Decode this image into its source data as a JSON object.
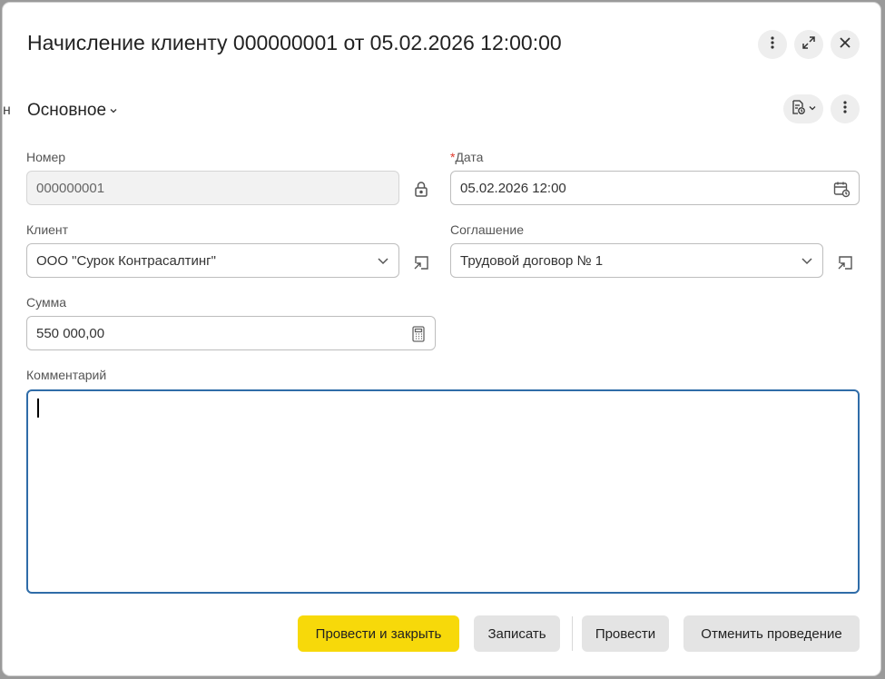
{
  "window": {
    "title": "Начисление клиенту 000000001 от 05.02.2026 12:00:00"
  },
  "section": {
    "title": "Основное"
  },
  "form": {
    "number": {
      "label": "Номер",
      "value": "000000001"
    },
    "date": {
      "required_mark": "*",
      "label": "Дата",
      "value": "05.02.2026 12:00"
    },
    "client": {
      "label": "Клиент",
      "value": "ООО \"Сурок Контрасалтинг\""
    },
    "agreement": {
      "label": "Соглашение",
      "value": "Трудовой договор № 1"
    },
    "sum": {
      "label": "Сумма",
      "value": "550 000,00"
    },
    "comment": {
      "label": "Комментарий",
      "value": ""
    }
  },
  "buttons": {
    "post_and_close": "Провести и закрыть",
    "save": "Записать",
    "post": "Провести",
    "cancel_posting": "Отменить проведение"
  },
  "colors": {
    "primary": "#f7d90a",
    "focus_border": "#2f6ca8",
    "required": "#e0392c"
  },
  "icons": [
    "more-icon",
    "expand-icon",
    "close-icon",
    "chevron-down-icon",
    "document-clock-icon",
    "lock-icon",
    "calendar-icon",
    "open-link-icon",
    "calculator-icon"
  ]
}
